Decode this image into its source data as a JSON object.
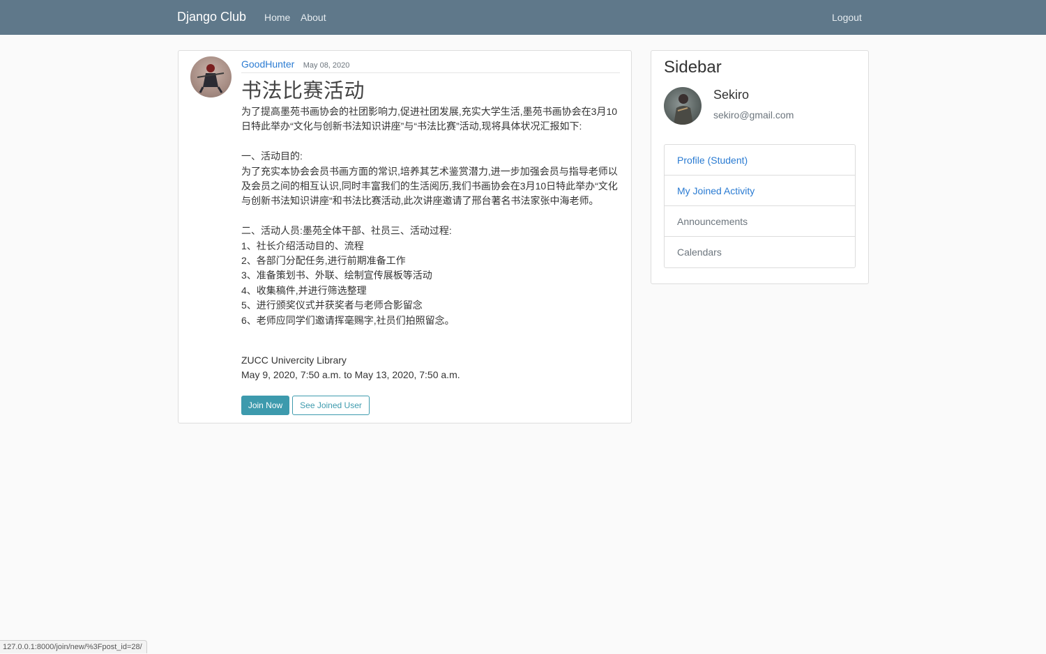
{
  "navbar": {
    "brand": "Django Club",
    "links": [
      "Home",
      "About"
    ],
    "logout": "Logout",
    "bg_color": "#5f788a"
  },
  "post": {
    "author": "GoodHunter",
    "date": "May 08, 2020",
    "title": "书法比赛活动",
    "paragraphs": [
      "为了提高墨苑书画协会的社团影响力,促进社团发展,充实大学生活,墨苑书画协会在3月10日特此举办“文化与创新书法知识讲座”与“书法比赛”活动,现将具体状况汇报如下:",
      "一、活动目的:\n为了充实本协会会员书画方面的常识,培养其艺术鉴赏潜力,进一步加强会员与指导老师以及会员之间的相互认识,同时丰富我们的生活阅历,我们书画协会在3月10日特此举办“文化与创新书法知识讲座“和书法比赛活动,此次讲座邀请了邢台著名书法家张中海老师。",
      "二、活动人员:墨苑全体干部、社员三、活动过程:\n1、社长介绍活动目的、流程\n2、各部门分配任务,进行前期准备工作\n3、准备策划书、外联、绘制宣传展板等活动\n4、收集稿件,并进行筛选整理\n5、进行颁奖仪式并获奖者与老师合影留念\n6、老师应同学们邀请挥毫赐字,社员们拍照留念。"
    ],
    "location": "ZUCC Univercity Library",
    "time_range": "May 9, 2020, 7:50 a.m. to May 13, 2020, 7:50 a.m.",
    "join_button": "Join Now",
    "see_joined_button": "See Joined User",
    "accent_color": "#3d9aad"
  },
  "sidebar": {
    "title": "Sidebar",
    "username": "Sekiro",
    "email": "sekiro@gmail.com",
    "items": [
      {
        "label": "Profile (Student)",
        "style": "link"
      },
      {
        "label": "My Joined Activity",
        "style": "link"
      },
      {
        "label": "Announcements",
        "style": "muted"
      },
      {
        "label": "Calendars",
        "style": "muted"
      }
    ]
  },
  "status_bar": {
    "url": "127.0.0.1:8000/join/new/%3Fpost_id=28/"
  }
}
